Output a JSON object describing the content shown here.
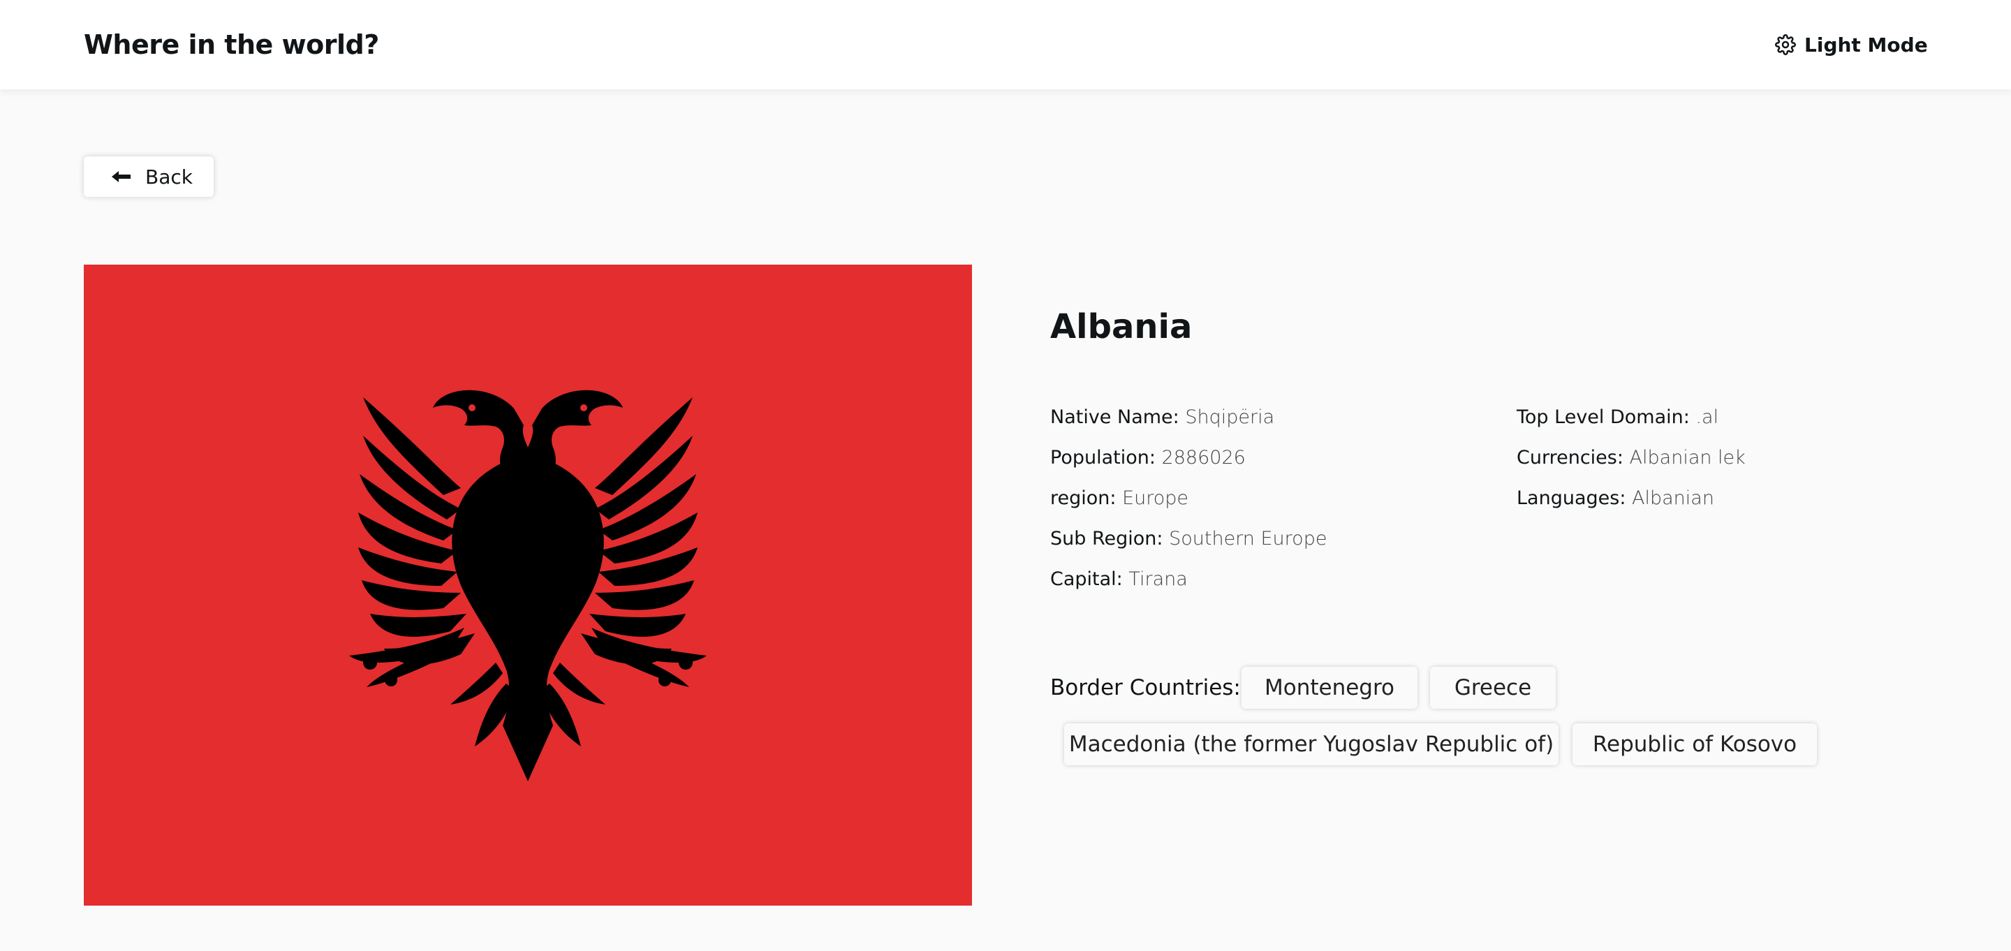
{
  "header": {
    "title": "Where in the world?",
    "mode_toggle_label": "Light Mode",
    "mode_icon": "gear-icon"
  },
  "back": {
    "label": "Back",
    "icon": "arrow-left-icon"
  },
  "flag": {
    "alt": "Flag of Albania",
    "background_color": "#e32d2e",
    "emblem_color": "#000000"
  },
  "country": {
    "name": "Albania",
    "left_column": [
      {
        "key": "Native Name:",
        "value": "Shqipëria"
      },
      {
        "key": "Population:",
        "value": "2886026"
      },
      {
        "key": "region:",
        "value": "Europe"
      },
      {
        "key": "Sub Region:",
        "value": "Southern Europe"
      },
      {
        "key": "Capital:",
        "value": "Tirana"
      }
    ],
    "right_column": [
      {
        "key": "Top Level Domain:",
        "value": ".al"
      },
      {
        "key": "Currencies:",
        "value": "Albanian lek"
      },
      {
        "key": "Languages:",
        "value": "Albanian"
      }
    ]
  },
  "borders": {
    "label": "Border Countries:",
    "countries": [
      "Montenegro",
      "Greece",
      "Macedonia (the former Yugoslav Republic of)",
      "Republic of Kosovo"
    ]
  }
}
